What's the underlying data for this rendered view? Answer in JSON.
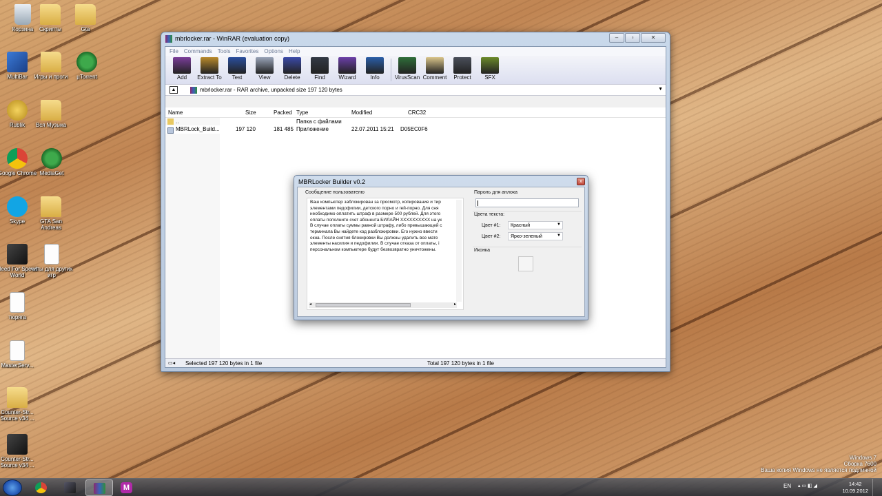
{
  "desktop": {
    "icons": [
      {
        "label": "Корзина",
        "icon": "recycle-bin-icon"
      },
      {
        "label": "Скрипты",
        "icon": "folder-icon"
      },
      {
        "label": "Gta",
        "icon": "folder-icon"
      },
      {
        "label": "MultiBar",
        "icon": "multibar-icon"
      },
      {
        "label": "Игры и проги",
        "icon": "folder-icon"
      },
      {
        "label": "µTorrent",
        "icon": "utorrent-icon"
      },
      {
        "label": "Rublik",
        "icon": "rublik-icon"
      },
      {
        "label": "Вся Музыка",
        "icon": "folder-icon"
      },
      {
        "label": "Google Chrome",
        "icon": "chrome-icon"
      },
      {
        "label": "MediaGet",
        "icon": "mediaget-icon"
      },
      {
        "label": "Skype",
        "icon": "skype-icon"
      },
      {
        "label": "GTA San Andreas",
        "icon": "folder-icon"
      },
      {
        "label": "Need For Speed World",
        "icon": "nfs-icon"
      },
      {
        "label": "читы для других игр",
        "icon": "document-icon"
      },
      {
        "label": "тюряга",
        "icon": "document-icon"
      },
      {
        "label": "MasterServ...",
        "icon": "document-icon"
      },
      {
        "label": "Counter-Str... Source v34 ...",
        "icon": "folder-icon"
      },
      {
        "label": "Counter-Str... Source v34 ...",
        "icon": "css-icon"
      }
    ]
  },
  "winrar": {
    "title": "mbrlocker.rar - WinRAR (evaluation copy)",
    "window_buttons": {
      "minimize": "‒",
      "maximize": "▫",
      "close": "✕"
    },
    "menu": [
      "File",
      "Commands",
      "Tools",
      "Favorites",
      "Options",
      "Help"
    ],
    "toolbar": [
      {
        "label": "Add",
        "icon": "add-icon",
        "color": "#7a3d99"
      },
      {
        "label": "Extract To",
        "icon": "extract-icon",
        "color": "#b98a2c"
      },
      {
        "label": "Test",
        "icon": "test-icon",
        "color": "#2b4f9e"
      },
      {
        "label": "View",
        "icon": "view-icon",
        "color": "#9aa4b8"
      },
      {
        "label": "Delete",
        "icon": "delete-icon",
        "color": "#3b4aa8"
      },
      {
        "label": "Find",
        "icon": "find-icon",
        "color": "#333a45"
      },
      {
        "label": "Wizard",
        "icon": "wizard-icon",
        "color": "#6b3fa8"
      },
      {
        "label": "Info",
        "icon": "info-icon",
        "color": "#2a5ea8"
      },
      {
        "label": "VirusScan",
        "icon": "virusscan-icon",
        "color": "#2f6e3a"
      },
      {
        "label": "Comment",
        "icon": "comment-icon",
        "color": "#d9c48a"
      },
      {
        "label": "Protect",
        "icon": "protect-icon",
        "color": "#4a4f5a"
      },
      {
        "label": "SFX",
        "icon": "sfx-icon",
        "color": "#6b8a2a"
      }
    ],
    "address": "mbrlocker.rar - RAR archive, unpacked size 197 120 bytes",
    "columns": [
      "Name",
      "Size",
      "Packed",
      "Type",
      "Modified",
      "CRC32"
    ],
    "rows": [
      {
        "name": "..",
        "size": "",
        "packed": "",
        "type": "Папка с файлами",
        "modified": "",
        "crc": "",
        "icon": "folder-up-icon"
      },
      {
        "name": "MBRLock_Build...",
        "size": "197 120",
        "packed": "181 485",
        "type": "Приложение",
        "modified": "22.07.2011 15:21",
        "crc": "D05EC0F6",
        "icon": "exe-icon"
      }
    ],
    "status_left": "Selected 197 120 bytes in 1 file",
    "status_right": "Total 197 120 bytes in 1 file"
  },
  "dialog": {
    "title": "MBRLocker Builder v0.2",
    "close": "x",
    "message_label": "Сообщение пользователю",
    "message_lines": [
      "Ваш компьютер заблокирован за просмотр, копирование и тир",
      "элементами педофилии, детского порно и гей-порно. Для сня",
      "необходимо оплатить штраф в размере 500 рублей. Для этого",
      "оплаты пополните счет абонента БИЛАЙН XXXXXXXXXX на ук",
      "В случае оплаты суммы равной штрафу, либо превышающей с",
      "терминала Вы найдете код разблокировки. Его нужно ввести",
      "окна. После снятия блокировки Вы должны удалить все мате",
      "элементы насилия и педофилии. В случае отказа от оплаты, i",
      "персональном компьютере будут безвозвратно уничтожены."
    ],
    "password_label": "Пароль для анлока",
    "password_value": "",
    "colors_label": "Цвета текста:",
    "color1_label": "Цвет #1:",
    "color1_value": "Красный",
    "color2_label": "Цвет #2:",
    "color2_value": "Ярко-зеленый",
    "icon_label": "Иконка"
  },
  "taskbar": {
    "items": [
      {
        "icon": "chrome-icon",
        "active": false
      },
      {
        "icon": "nfs-icon",
        "active": false
      },
      {
        "icon": "winrar-icon",
        "active": true
      },
      {
        "icon": "mediaget-icon",
        "active": false
      }
    ],
    "lang": "EN",
    "time": "14:42",
    "date": "10.09.2012"
  },
  "watermark": {
    "line1": "Windows 7",
    "line2": "Сборка 7600",
    "line3": "Ваша копия Windows не является подлинной"
  }
}
